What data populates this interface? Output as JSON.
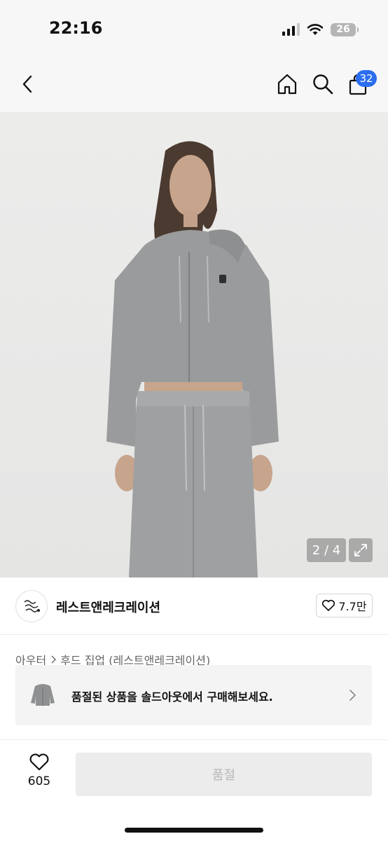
{
  "status": {
    "time": "22:16",
    "battery": "26"
  },
  "header": {
    "cart_badge": "32"
  },
  "gallery": {
    "pager": "2 / 4"
  },
  "brand": {
    "name": "레스트앤레크레이션",
    "like_count": "7.7만"
  },
  "breadcrumb": {
    "items": [
      "아우터",
      "후드 집업 (레스트앤레크레이션)"
    ]
  },
  "banner": {
    "text": "품절된 상품을 솔드아웃에서 구매해보세요."
  },
  "bottom": {
    "wish_count": "605",
    "action_label": "품절"
  },
  "colors": {
    "accent": "#2b6ef0",
    "disabled_bg": "#ececec",
    "disabled_text": "#b7b7b7",
    "garment": "#9a9b9c"
  }
}
